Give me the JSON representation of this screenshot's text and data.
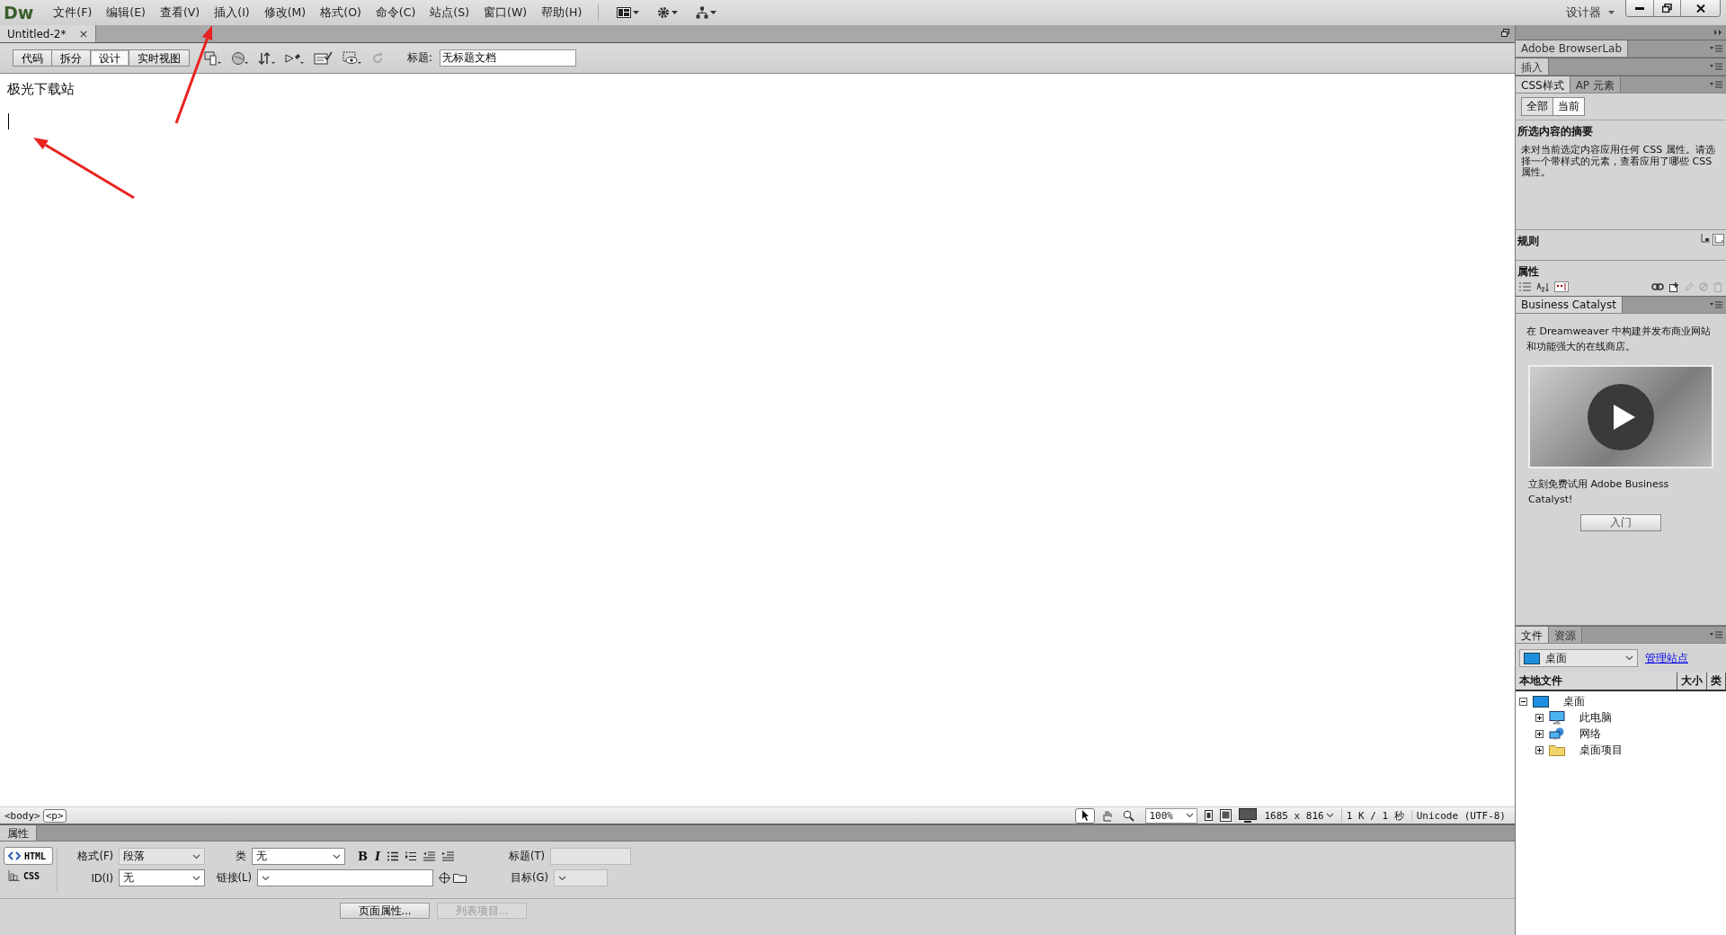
{
  "menu_bar": {
    "logo": "Dw",
    "menus": [
      "文件(F)",
      "编辑(E)",
      "查看(V)",
      "插入(I)",
      "修改(M)",
      "格式(O)",
      "命令(C)",
      "站点(S)",
      "窗口(W)",
      "帮助(H)"
    ],
    "workspace": "设计器"
  },
  "document_tab": {
    "title": "Untitled-2*",
    "close": "×"
  },
  "view_buttons": [
    {
      "label": "代码",
      "selected": false
    },
    {
      "label": "拆分",
      "selected": false
    },
    {
      "label": "设计",
      "selected": true
    },
    {
      "label": "实时视图",
      "selected": false
    }
  ],
  "title_field": {
    "label": "标题:",
    "value": "无标题文档"
  },
  "page_text": "极光下载站",
  "tag_selector": [
    {
      "label": "<body>",
      "selected": false
    },
    {
      "label": "<p>",
      "selected": true
    }
  ],
  "status_bar": {
    "tools": [
      {
        "kind": "pointer",
        "selected": true
      },
      {
        "kind": "hand",
        "selected": false
      },
      {
        "kind": "zoom",
        "selected": false
      }
    ],
    "zoom": "100%",
    "dimensions": "1685 x 816",
    "download": "1 K / 1 秒",
    "encoding": "Unicode (UTF-8)"
  },
  "properties": {
    "tab": "属性",
    "modes": [
      {
        "label": "HTML",
        "selected": true
      },
      {
        "label": "CSS",
        "selected": false
      }
    ],
    "format": {
      "label": "格式(F)",
      "value": "段落"
    },
    "id": {
      "label": "ID(I)",
      "value": "无"
    },
    "class": {
      "label": "类",
      "value": "无"
    },
    "link": {
      "label": "链接(L)"
    },
    "bold": "B",
    "italic": "I",
    "title": {
      "label": "标题(T)",
      "disabled": true
    },
    "target": {
      "label": "目标(G)",
      "disabled": true
    },
    "buttons": [
      {
        "label": "页面属性...",
        "disabled": false
      },
      {
        "label": "列表项目...",
        "disabled": true
      }
    ]
  },
  "side_panels": {
    "browserlab": "Adobe BrowserLab",
    "insert": "插入",
    "css_tabs": [
      {
        "label": "CSS样式",
        "selected": true
      },
      {
        "label": "AP 元素",
        "selected": false
      }
    ],
    "css_modes": [
      {
        "label": "全部",
        "selected": false
      },
      {
        "label": "当前",
        "selected": true
      }
    ],
    "summary_heading": "所选内容的摘要",
    "summary_text": "未对当前选定内容应用任何 CSS 属性。请选择一个带样式的元素，查看应用了哪些 CSS 属性。",
    "rules_heading": "规则",
    "properties_heading": "属性"
  },
  "business_catalyst": {
    "tab": "Business Catalyst",
    "text": "在 Dreamweaver 中构建并发布商业网站和功能强大的在线商店。",
    "promo": "立刻免费试用 Adobe Business Catalyst!",
    "button": "入门"
  },
  "files": {
    "tabs": [
      {
        "label": "文件",
        "selected": true
      },
      {
        "label": "资源",
        "selected": false
      }
    ],
    "location": "桌面",
    "manage_link": "管理站点",
    "columns": [
      "本地文件",
      "大小",
      "类"
    ],
    "tree": [
      {
        "label": "桌面",
        "kind": "desktop",
        "expanded": true,
        "children": [
          {
            "label": "此电脑",
            "kind": "computer",
            "expanded": false
          },
          {
            "label": "网络",
            "kind": "network",
            "expanded": false
          },
          {
            "label": "桌面项目",
            "kind": "folder",
            "expanded": false
          }
        ]
      }
    ]
  }
}
